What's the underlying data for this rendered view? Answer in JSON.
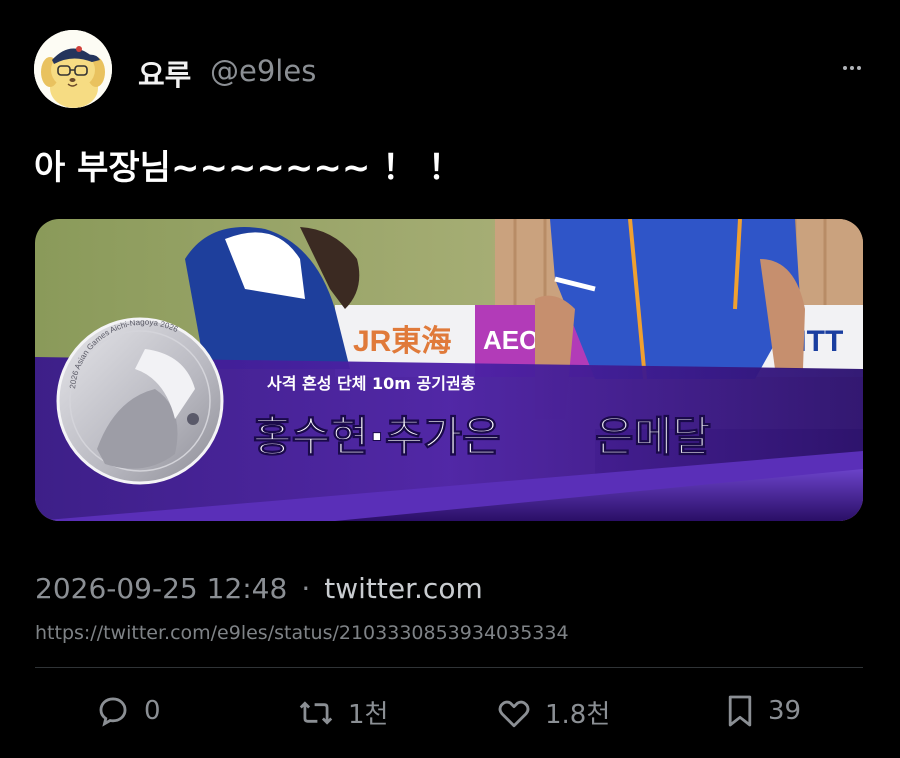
{
  "author": {
    "display_name": "요루",
    "handle": "@e9les",
    "avatar_icon": "cartoon-dog-avatar"
  },
  "tweet": {
    "text": "아 부장님~~~~~~~ ！ ！"
  },
  "media": {
    "caption_small": "사격 혼성 단체 10m 공기권총",
    "caption_large_part1": "홍수현·추가은",
    "caption_large_part2": "은메달",
    "medal_text": "2026 Asian Games Aichi-Nagoya 2026",
    "sponsor_1": "JR東海",
    "sponsor_2": "AEON",
    "sponsor_3": "NTT"
  },
  "meta": {
    "timestamp": "2026-09-25 12:48",
    "separator": "·",
    "source": "twitter.com",
    "url": "https://twitter.com/e9les/status/2103330853934035334"
  },
  "actions": {
    "reply_count": "0",
    "retweet_count": "1천",
    "like_count": "1.8천",
    "bookmark_count": "39"
  },
  "colors": {
    "background": "#000000",
    "text_primary": "#e7e9ea",
    "text_secondary": "#8b8f94",
    "divider": "#2f3336",
    "banner_purple": "#4a1fa0"
  }
}
